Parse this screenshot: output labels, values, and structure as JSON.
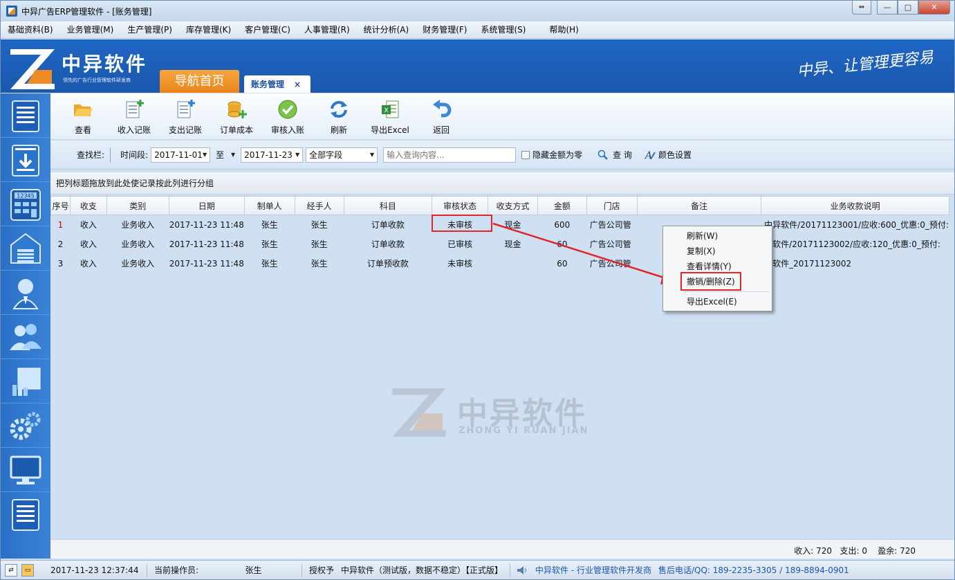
{
  "window": {
    "title": "中异广告ERP管理软件 - [账务管理]",
    "buttons": {
      "restore": "⇔",
      "minimize": "—",
      "maximize": "□",
      "close": "✕"
    }
  },
  "menubar": [
    "基础资料(B)",
    "业务管理(M)",
    "生产管理(P)",
    "库存管理(K)",
    "客户管理(C)",
    "人事管理(R)",
    "统计分析(A)",
    "财务管理(F)",
    "系统管理(S)",
    "帮助(H)"
  ],
  "banner": {
    "brand": "中异软件",
    "tagline": "领先的广告行业管理软件研发商",
    "slogan": "中异、让管理更容易",
    "nav_home": "导航首页",
    "active_tab": "账务管理",
    "tab_close": "×",
    "brand_color": "#1f66c4",
    "accent_color": "#e8841c"
  },
  "sidebar": [
    {
      "icon": "clipboard-icon"
    },
    {
      "icon": "download-doc-icon"
    },
    {
      "icon": "calculator-icon"
    },
    {
      "icon": "warehouse-icon"
    },
    {
      "icon": "customer-service-icon"
    },
    {
      "icon": "users-icon"
    },
    {
      "icon": "chart-icon"
    },
    {
      "icon": "gears-icon"
    },
    {
      "icon": "monitor-icon"
    },
    {
      "icon": "document-icon"
    }
  ],
  "toolbar": [
    {
      "label": "查看",
      "icon": "folder-open-icon"
    },
    {
      "label": "收入记账",
      "icon": "doc-add-icon"
    },
    {
      "label": "支出记账",
      "icon": "doc-add-icon"
    },
    {
      "label": "订单成本",
      "icon": "coins-add-icon"
    },
    {
      "label": "审核入账",
      "icon": "checkmark-icon"
    },
    {
      "label": "刷新",
      "icon": "refresh-icon"
    },
    {
      "label": "导出Excel",
      "icon": "excel-icon"
    },
    {
      "label": "返回",
      "icon": "back-arrow-icon"
    }
  ],
  "search": {
    "label": "查找栏:",
    "period_label": "时间段:",
    "date_from": "2017-11-01",
    "to_label": "至",
    "date_to": "2017-11-23",
    "field": "全部字段",
    "query_placeholder": "输入查询内容...",
    "hide_zero_label": "隐藏金额为零",
    "query_btn": "查 询",
    "color_btn": "颜色设置"
  },
  "group_hint": "把列标题拖放到此处使记录按此列进行分组",
  "table": {
    "columns": [
      "序号",
      "收支",
      "类别",
      "日期",
      "制单人",
      "经手人",
      "科目",
      "审核状态",
      "收支方式",
      "金额",
      "门店",
      "备注",
      "业务收款说明"
    ],
    "rows": [
      [
        "1",
        "收入",
        "业务收入",
        "2017-11-23 11:48",
        "张生",
        "张生",
        "订单收款",
        "未审核",
        "现金",
        "600",
        "广告公司管",
        "",
        "中异软件/20171123001/应收:600_优惠:0_预付:"
      ],
      [
        "2",
        "收入",
        "业务收入",
        "2017-11-23 11:48",
        "张生",
        "张生",
        "订单收款",
        "已审核",
        "现金",
        "60",
        "广告公司管",
        "",
        "异软件/20171123002/应收:120_优惠:0_预付:"
      ],
      [
        "3",
        "收入",
        "业务收入",
        "2017-11-23 11:48",
        "张生",
        "张生",
        "订单预收款",
        "未审核",
        "",
        "60",
        "广告公司管",
        "",
        "异软件_20171123002"
      ]
    ]
  },
  "context_menu": [
    "刷新(W)",
    "复制(X)",
    "查看详情(Y)",
    "撤销/删除(Z)",
    "导出Excel(E)"
  ],
  "watermark": {
    "name": "中异软件",
    "sub": "ZHONG YI RUAN JIAN"
  },
  "summary": "收入: 720   支出: 0    盈余: 720",
  "status": {
    "datetime": "2017-11-23 12:37:44",
    "operator_label": "当前操作员:",
    "operator": "张生",
    "license_label": "授权予",
    "license": "中异软件（测试版，数据不稳定）【正式版】",
    "vendor": "中异软件 - 行业管理软件开发商",
    "hotline": "售后电话/QQ:  189-2235-3305 / 189-8894-0901"
  },
  "highlight_color": "#e0262a"
}
